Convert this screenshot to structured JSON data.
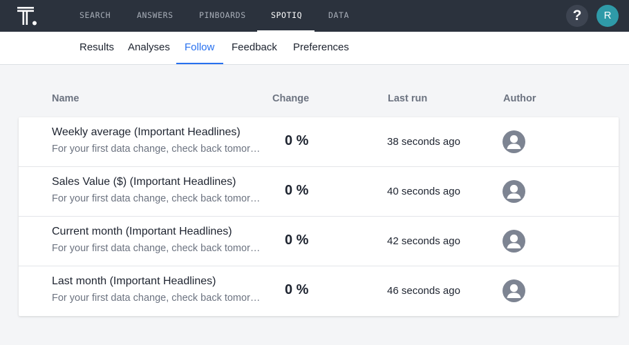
{
  "topnav": {
    "items": [
      {
        "label": "SEARCH"
      },
      {
        "label": "ANSWERS"
      },
      {
        "label": "PINBOARDS"
      },
      {
        "label": "SPOTIQ",
        "active": true
      },
      {
        "label": "DATA"
      }
    ],
    "help_label": "?",
    "user_initial": "R"
  },
  "tabs": [
    {
      "label": "Results"
    },
    {
      "label": "Analyses"
    },
    {
      "label": "Follow",
      "active": true
    },
    {
      "label": "Feedback"
    },
    {
      "label": "Preferences"
    }
  ],
  "table": {
    "headers": {
      "name": "Name",
      "change": "Change",
      "last_run": "Last run",
      "author": "Author"
    },
    "rows": [
      {
        "title": "Weekly average (Important Headlines)",
        "subtitle": "For your first data change, check back tomorrow.",
        "change": "0 %",
        "last_run": "38 seconds ago"
      },
      {
        "title": "Sales Value ($) (Important Headlines)",
        "subtitle": "For your first data change, check back tomorrow.",
        "change": "0 %",
        "last_run": "40 seconds ago"
      },
      {
        "title": "Current month (Important Headlines)",
        "subtitle": "For your first data change, check back tomorrow.",
        "change": "0 %",
        "last_run": "42 seconds ago"
      },
      {
        "title": "Last month (Important Headlines)",
        "subtitle": "For your first data change, check back tomorrow.",
        "change": "0 %",
        "last_run": "46 seconds ago"
      }
    ]
  },
  "colors": {
    "nav_bg": "#2b323d",
    "accent": "#2770ef",
    "avatar": "#2f9aa8"
  },
  "icons": {
    "logo": "thoughtspot-logo-icon",
    "author": "user-avatar-icon"
  }
}
